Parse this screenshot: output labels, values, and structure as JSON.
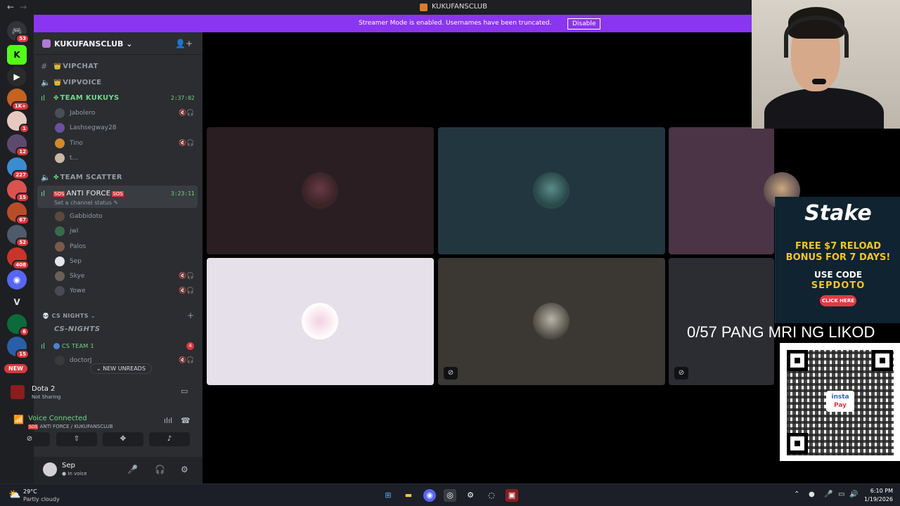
{
  "window": {
    "title": "KUKUFANSCLUB",
    "nav_back": "←",
    "nav_forward": "→"
  },
  "banner": {
    "message": "Streamer Mode is enabled. Usernames have been truncated.",
    "button": "Disable"
  },
  "rail": {
    "servers": [
      {
        "name": "discord-home",
        "badge": "53",
        "color": "#313338",
        "glyph": "🎮"
      },
      {
        "name": "kick",
        "badge": "",
        "color": "#53fc18",
        "glyph": "K"
      },
      {
        "name": "play",
        "badge": "",
        "color": "#2a2a2a",
        "glyph": "▶"
      },
      {
        "name": "server-3",
        "badge": "1K+",
        "color": "#c4621e",
        "glyph": ""
      },
      {
        "name": "server-4",
        "badge": "1",
        "color": "#e8c9c1",
        "glyph": ""
      },
      {
        "name": "server-5",
        "badge": "12",
        "color": "#5c4a6e",
        "glyph": ""
      },
      {
        "name": "server-6",
        "badge": "227",
        "color": "#3b8ccf",
        "glyph": ""
      },
      {
        "name": "server-7",
        "badge": "15",
        "color": "#d9534f",
        "glyph": ""
      },
      {
        "name": "server-8",
        "badge": "67",
        "color": "#b84d2a",
        "glyph": ""
      },
      {
        "name": "server-9",
        "badge": "52",
        "color": "#4f5a6a",
        "glyph": ""
      },
      {
        "name": "server-10",
        "badge": "408",
        "color": "#c9342d",
        "glyph": ""
      },
      {
        "name": "server-11",
        "badge": "",
        "color": "#5865f2",
        "glyph": "◉"
      },
      {
        "name": "server-12",
        "badge": "",
        "color": "#1e1f22",
        "glyph": "V"
      },
      {
        "name": "server-13",
        "badge": "6",
        "color": "#0c6b3a",
        "glyph": ""
      },
      {
        "name": "server-14",
        "badge": "15",
        "color": "#2a5fa8",
        "glyph": ""
      }
    ],
    "new_label": "NEW"
  },
  "server": {
    "name": "KUKUFANSCLUB",
    "invite_icon": "add-user-icon"
  },
  "channels": {
    "vipchat": "VIPCHAT",
    "vipvoice": "VIPVOICE",
    "team_kukuys": "TEAM KUKUYS",
    "team_kukuys_timer": "2:37:02",
    "team_scatter": "TEAM SCATTER",
    "anti_force": "ANTI FORCE",
    "anti_force_timer": "3:23:11",
    "anti_force_status": "Set a channel status",
    "cs_nights_category": "CS NIGHTS",
    "cs_nights": "CS-NIGHTS",
    "cs_team": "CS TEAM 1",
    "cs_team_count": "4",
    "new_unreads": "NEW UNREADS"
  },
  "members_kukuys": [
    "Jabolero",
    "Lashsegway28",
    "Tino",
    "t..."
  ],
  "members_anti": [
    "Gabbidoto",
    "jwl",
    "Palos",
    "Sep",
    "Skye",
    "Yowe"
  ],
  "members_cs": [
    "doctorJ"
  ],
  "activity": {
    "game": "Dota 2",
    "status": "Not Sharing"
  },
  "voice": {
    "status": "Voice Connected",
    "channel": "ANTI FORCE / KUKUFANSCLUB"
  },
  "user": {
    "name": "Sep",
    "status": "In voice"
  },
  "ads": {
    "stake_logo": "Stake",
    "stake_headline_1": "FREE $7 RELOAD",
    "stake_headline_2": "BONUS FOR 7 DAYS!",
    "stake_use_code": "USE CODE",
    "stake_code": "SEPDOTO",
    "stake_cta": "CLICK HERE",
    "overlay_text": "0/57 PANG MRI NG LIKOD",
    "qr_logo_top": "insta",
    "qr_logo_bottom": "Pay"
  },
  "taskbar": {
    "temp": "29°C",
    "condition": "Partly cloudy",
    "time": "6:10 PM",
    "date": "1/19/2026"
  },
  "colors": {
    "blurple": "#5865f2",
    "green": "#23a55a",
    "streamer_purple": "#8a35f0",
    "stake_yellow": "#f3c623"
  }
}
